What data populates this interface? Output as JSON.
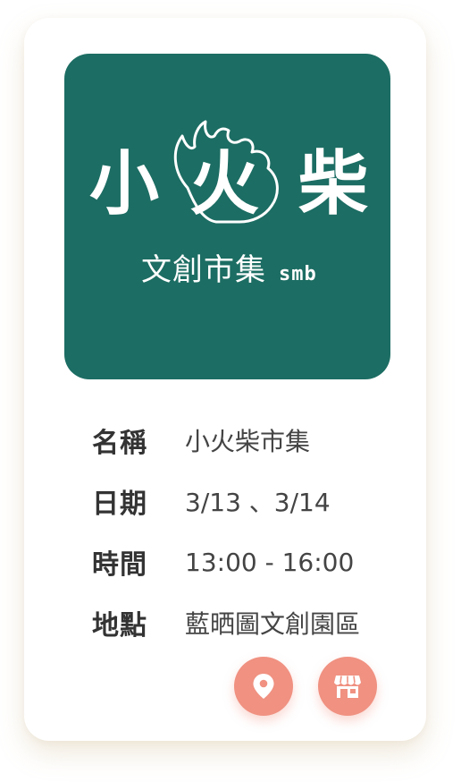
{
  "logo": {
    "title_chars": [
      "小",
      "火",
      "柴"
    ],
    "subtitle": "文創市集",
    "subtitle_en": "smb",
    "background_color": "#1c6d63"
  },
  "info": {
    "rows": [
      {
        "label": "名稱",
        "value": "小火柴市集"
      },
      {
        "label": "日期",
        "value": "3/13 、3/14"
      },
      {
        "label": "時間",
        "value": "13:00 - 16:00"
      },
      {
        "label": "地點",
        "value": "藍晒圖文創園區"
      }
    ]
  },
  "actions": {
    "map_icon": "map-pin-icon",
    "shop_icon": "storefront-icon",
    "button_color": "#f09181"
  }
}
